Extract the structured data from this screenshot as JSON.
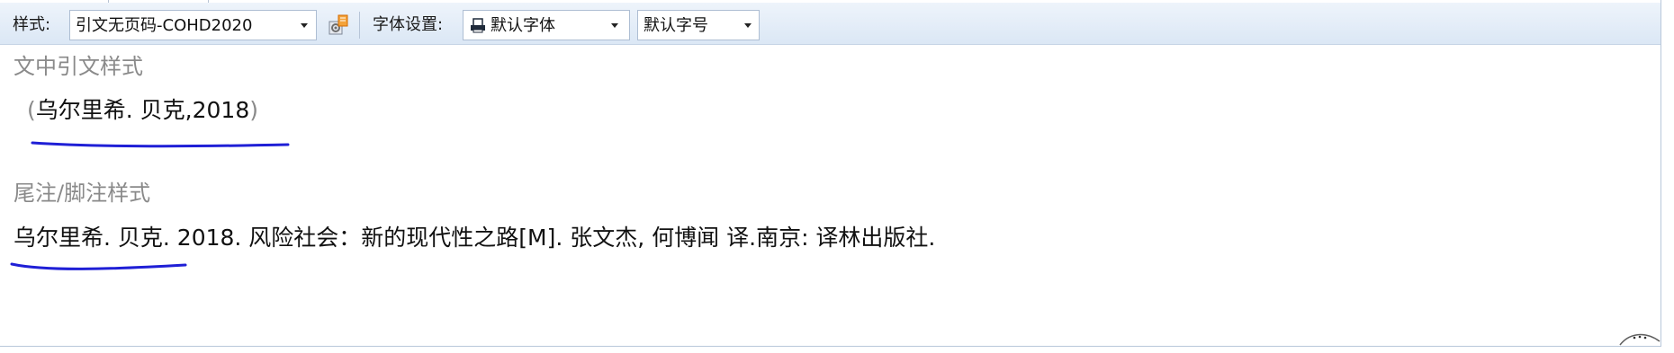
{
  "toolbar": {
    "style_label": "样式:",
    "style_value": "引文无页码-COHD2020",
    "font_label": "字体设置:",
    "font_value": "默认字体",
    "size_value": "默认字号"
  },
  "content": {
    "in_text_title": "文中引文样式",
    "in_text_open_paren": "(",
    "in_text_citation": "乌尔里希. 贝克,2018",
    "in_text_close_paren": ")",
    "footnote_title": "尾注/脚注样式",
    "footnote_citation": "乌尔里希. 贝克. 2018. 风险社会：新的现代性之路[M]. 张文杰, 何博闻 译.南京: 译林出版社."
  },
  "colors": {
    "toolbar_bg": "#dbe7f5",
    "title_gray": "#8a8a8a",
    "annotation_blue": "#1f1fd6"
  },
  "icons": [
    "style-editor-icon",
    "printer-font-icon",
    "dropdown-arrow-icon"
  ]
}
